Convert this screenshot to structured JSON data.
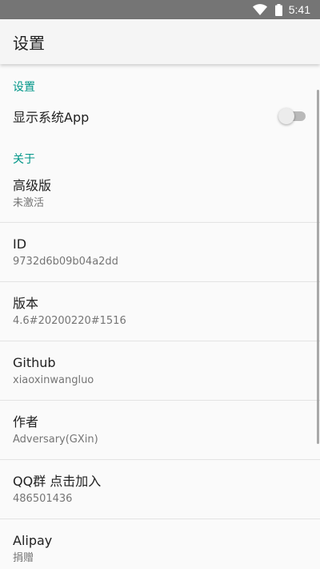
{
  "status_bar": {
    "time": "5:41"
  },
  "app_bar": {
    "title": "设置"
  },
  "sections": {
    "settings_header": "设置",
    "about_header": "关于"
  },
  "settings": {
    "show_system_apps": {
      "label": "显示系统App",
      "enabled": false
    }
  },
  "about": [
    {
      "title": "高级版",
      "summary": "未激活"
    },
    {
      "title": "ID",
      "summary": "9732d6b09b04a2dd"
    },
    {
      "title": "版本",
      "summary": "4.6#20200220#1516"
    },
    {
      "title": "Github",
      "summary": "xiaoxinwangluo"
    },
    {
      "title": "作者",
      "summary": "Adversary(GXin)"
    },
    {
      "title": "QQ群 点击加入",
      "summary": "486501436"
    },
    {
      "title": "Alipay",
      "summary": "捐赠"
    }
  ],
  "colors": {
    "accent": "#009688",
    "status_bar": "#757575",
    "app_bar": "#f5f5f5",
    "background": "#fafafa"
  }
}
